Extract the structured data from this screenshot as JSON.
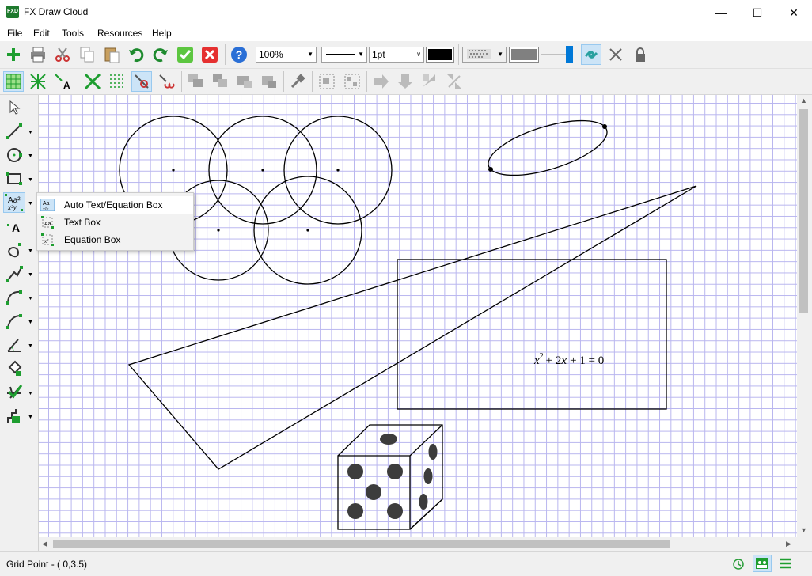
{
  "window": {
    "title": "FX Draw Cloud",
    "app_icon_text": "FXD",
    "minimize_glyph": "—",
    "maximize_glyph": "☐",
    "close_glyph": "✕"
  },
  "menu": {
    "file": "File",
    "edit": "Edit",
    "tools": "Tools",
    "resources": "Resources",
    "help": "Help"
  },
  "toolbar": {
    "zoom": "100%",
    "line_width": "1pt",
    "line_color": "#000000",
    "fill_color": "#808080"
  },
  "left_tools": [
    "pointer-tool",
    "line-tool",
    "circle-tool",
    "rectangle-tool",
    "text-equation-tool",
    "text-label-tool",
    "curve-tool",
    "polyline-tool",
    "arc-tool",
    "bezier-tool",
    "angle-tool",
    "fill-tool",
    "graph-tool",
    "steps-tool"
  ],
  "text_menu": {
    "items": [
      {
        "label": "Auto Text/Equation Box",
        "icon": "auto-text-icon"
      },
      {
        "label": "Text Box",
        "icon": "text-box-icon"
      },
      {
        "label": "Equation Box",
        "icon": "equation-box-icon"
      }
    ]
  },
  "equation": {
    "x": "x",
    "exp": "2",
    "rest": "+ 2",
    "x2": "x",
    "tail": "+ 1  =  0"
  },
  "status": {
    "text": "Grid Point - ( 0,3.5)"
  },
  "colors": {
    "grid": "#b9b6ef",
    "accent_green": "#1e9e30",
    "selection": "#cce4f7"
  }
}
